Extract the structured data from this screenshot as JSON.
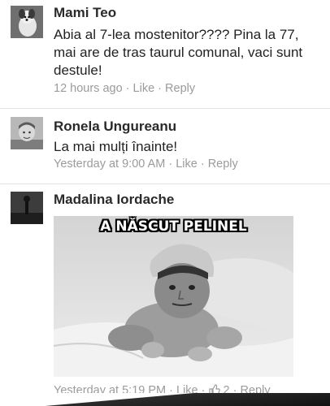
{
  "comments": [
    {
      "name": "Mami Teo",
      "text": "Abia al 7-lea mostenitor???? Pina la 77, mai are de tras taurul comunal, vaci sunt destule!",
      "time": "12 hours ago",
      "like": "Like",
      "reply": "Reply"
    },
    {
      "name": "Ronela Ungureanu",
      "text": "La mai mulți înainte!",
      "time": "Yesterday at 9:00 AM",
      "like": "Like",
      "reply": "Reply"
    },
    {
      "name": "Madalina Iordache",
      "image_caption": "A NĂSCUT PELINEL",
      "time": "Yesterday at 5:19 PM",
      "like": "Like",
      "like_count": "2",
      "reply": "Reply"
    }
  ],
  "separator": " · ",
  "icons": {
    "avatar": "profile-photo",
    "like_count_icon": "thumbs-up-icon"
  }
}
